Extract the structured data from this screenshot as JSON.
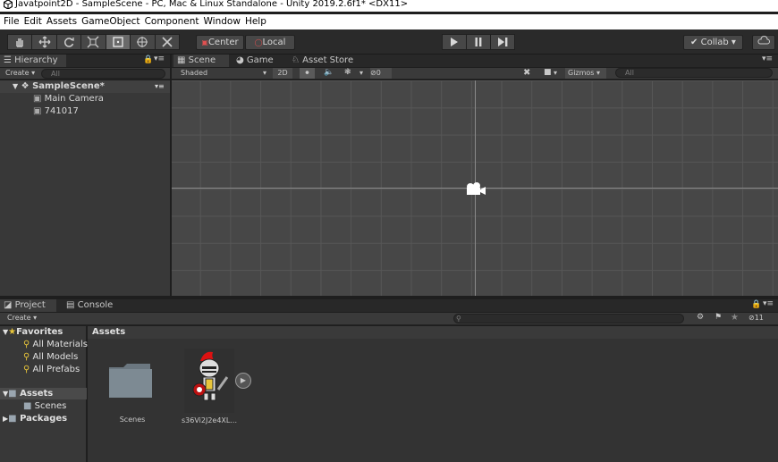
{
  "window": {
    "title": "Javatpoint2D - SampleScene - PC, Mac & Linux Standalone - Unity 2019.2.6f1* <DX11>"
  },
  "menu": [
    "File",
    "Edit",
    "Assets",
    "GameObject",
    "Component",
    "Window",
    "Help"
  ],
  "toolbar": {
    "pivot": "Center",
    "space": "Local",
    "collab": "Collab ▾"
  },
  "hierarchy": {
    "tab": "Hierarchy",
    "create": "Create ▾",
    "search_placeholder": "All",
    "scene_name": "SampleScene*",
    "items": [
      "Main Camera",
      "741017"
    ]
  },
  "scene_view": {
    "tabs": [
      "Scene",
      "Game",
      "Asset Store"
    ],
    "shading": "Shaded",
    "mode_2d": "2D",
    "hidden_count": "0",
    "gizmos": "Gizmos",
    "search_placeholder": "All"
  },
  "project": {
    "tabs": [
      "Project",
      "Console"
    ],
    "create": "Create ▾",
    "hidden_count": "11",
    "favorites": {
      "label": "Favorites",
      "items": [
        "All Materials",
        "All Models",
        "All Prefabs"
      ]
    },
    "assets": {
      "label": "Assets",
      "children": [
        "Scenes"
      ]
    },
    "packages": "Packages",
    "breadcrumb": "Assets",
    "grid_items": [
      "Scenes",
      "s36Vi2J2e4XL..."
    ]
  },
  "colors": {
    "panel": "#383838",
    "toolbar": "#2a2a2a",
    "scene_bg": "#474747",
    "gold": "#e8c53a"
  }
}
